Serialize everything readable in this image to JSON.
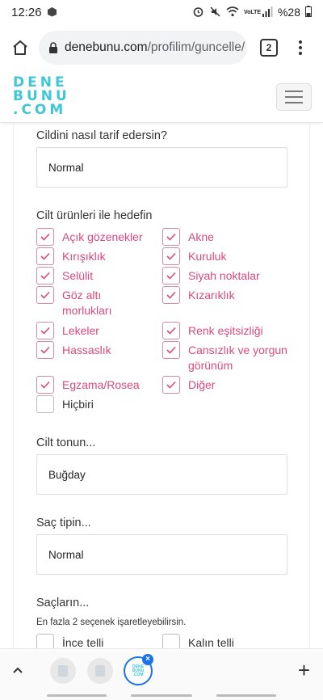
{
  "status": {
    "time": "12:26",
    "battery": "%28",
    "network": "VoLTE"
  },
  "browser": {
    "url_domain": "denebunu.com",
    "url_path": "/profilim/guncelle/",
    "tab_count": "2"
  },
  "site": {
    "logo_lines": [
      "DENE",
      "BUNU",
      ".COM"
    ]
  },
  "form": {
    "skin_question": "Cildini nasıl tarif edersin?",
    "skin_value": "Normal",
    "goals_question": "Cilt ürünleri ile hedefin",
    "goals": [
      {
        "label": "Açık gözenekler",
        "checked": true
      },
      {
        "label": "Akne",
        "checked": true
      },
      {
        "label": "Kırışıklık",
        "checked": true
      },
      {
        "label": "Kuruluk",
        "checked": true
      },
      {
        "label": "Selülit",
        "checked": true
      },
      {
        "label": "Siyah noktalar",
        "checked": true
      },
      {
        "label": "Göz altı morlukları",
        "checked": true
      },
      {
        "label": "Kızarıklık",
        "checked": true
      },
      {
        "label": "Lekeler",
        "checked": true
      },
      {
        "label": "Renk eşitsizliği",
        "checked": true
      },
      {
        "label": "Hassaslık",
        "checked": true
      },
      {
        "label": "Cansızlık ve yorgun görünüm",
        "checked": true
      },
      {
        "label": "Egzama/Rosea",
        "checked": true
      },
      {
        "label": "Diğer",
        "checked": true
      },
      {
        "label": "Hiçbiri",
        "checked": false
      }
    ],
    "skin_tone_question": "Cilt tonun...",
    "skin_tone_value": "Buğday",
    "hair_type_question": "Saç tipin...",
    "hair_type_value": "Normal",
    "hair_question": "Saçların...",
    "hair_hint": "En fazla 2 seçenek işaretleyebilirsin.",
    "hair_options": [
      {
        "label": "İnce telli",
        "checked": false
      },
      {
        "label": "Kalın telli",
        "checked": false
      }
    ]
  },
  "colors": {
    "accent": "#d9497d",
    "brand": "#3ec6d9",
    "tab_active": "#1a73e8"
  }
}
